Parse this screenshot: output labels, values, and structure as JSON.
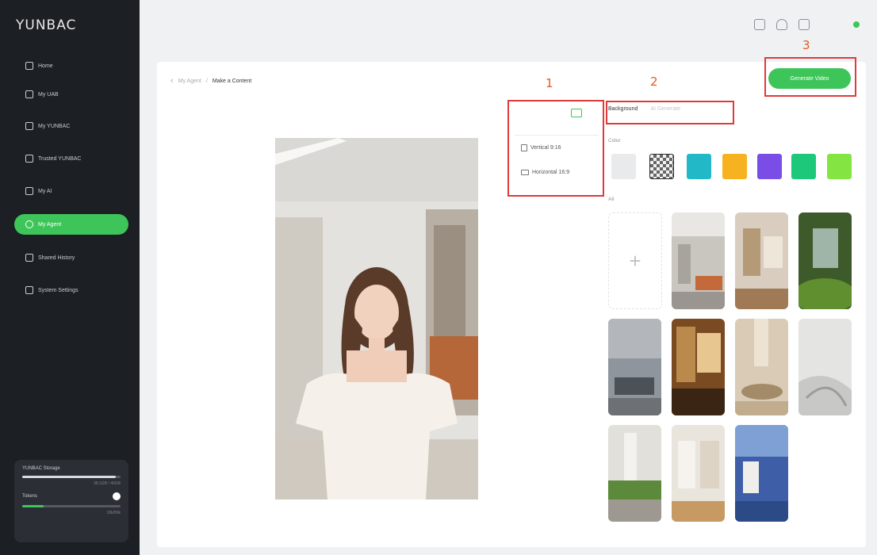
{
  "app": {
    "logo": "YUNBAC"
  },
  "sidebar": {
    "items": [
      {
        "label": "Home",
        "active": false
      },
      {
        "label": "My UAB",
        "active": false
      },
      {
        "label": "My YUNBAC",
        "active": false
      },
      {
        "label": "Trusted YUNBAC",
        "active": false
      },
      {
        "label": "My AI",
        "active": false
      },
      {
        "label": "My Agent",
        "active": true
      },
      {
        "label": "Shared History",
        "active": false
      },
      {
        "label": "System Settings",
        "active": false
      }
    ],
    "storage": {
      "title": "YUNBAC Storage",
      "used_fraction": 0.95,
      "caption": "38.1GB / 40GB",
      "token_label": "Tokens",
      "token_fraction": 0.22,
      "token_caption": "18k/80k"
    }
  },
  "breadcrumb": {
    "back": "‹",
    "sep": "/",
    "parent": "My Agent",
    "current": "Make a Content"
  },
  "annotations": {
    "one": "1",
    "two": "2",
    "three": "3"
  },
  "actions": {
    "generate": "Generate Video"
  },
  "orientation": {
    "vertical": "Vertical 9:16",
    "horizontal": "Horizontal 16:9"
  },
  "background_panel": {
    "tabs": [
      "Background",
      "AI Generate"
    ],
    "color_label": "Color",
    "colors": [
      "#e9eaec",
      "transparent",
      "#22b8c8",
      "#f6b221",
      "#7a4ee6",
      "#1ec87a",
      "#84e542"
    ],
    "image_label": "All"
  },
  "colors": {
    "accent": "#3ec55a",
    "sidebar_bg": "#1c1f24",
    "annotation": "#e03a3a"
  }
}
